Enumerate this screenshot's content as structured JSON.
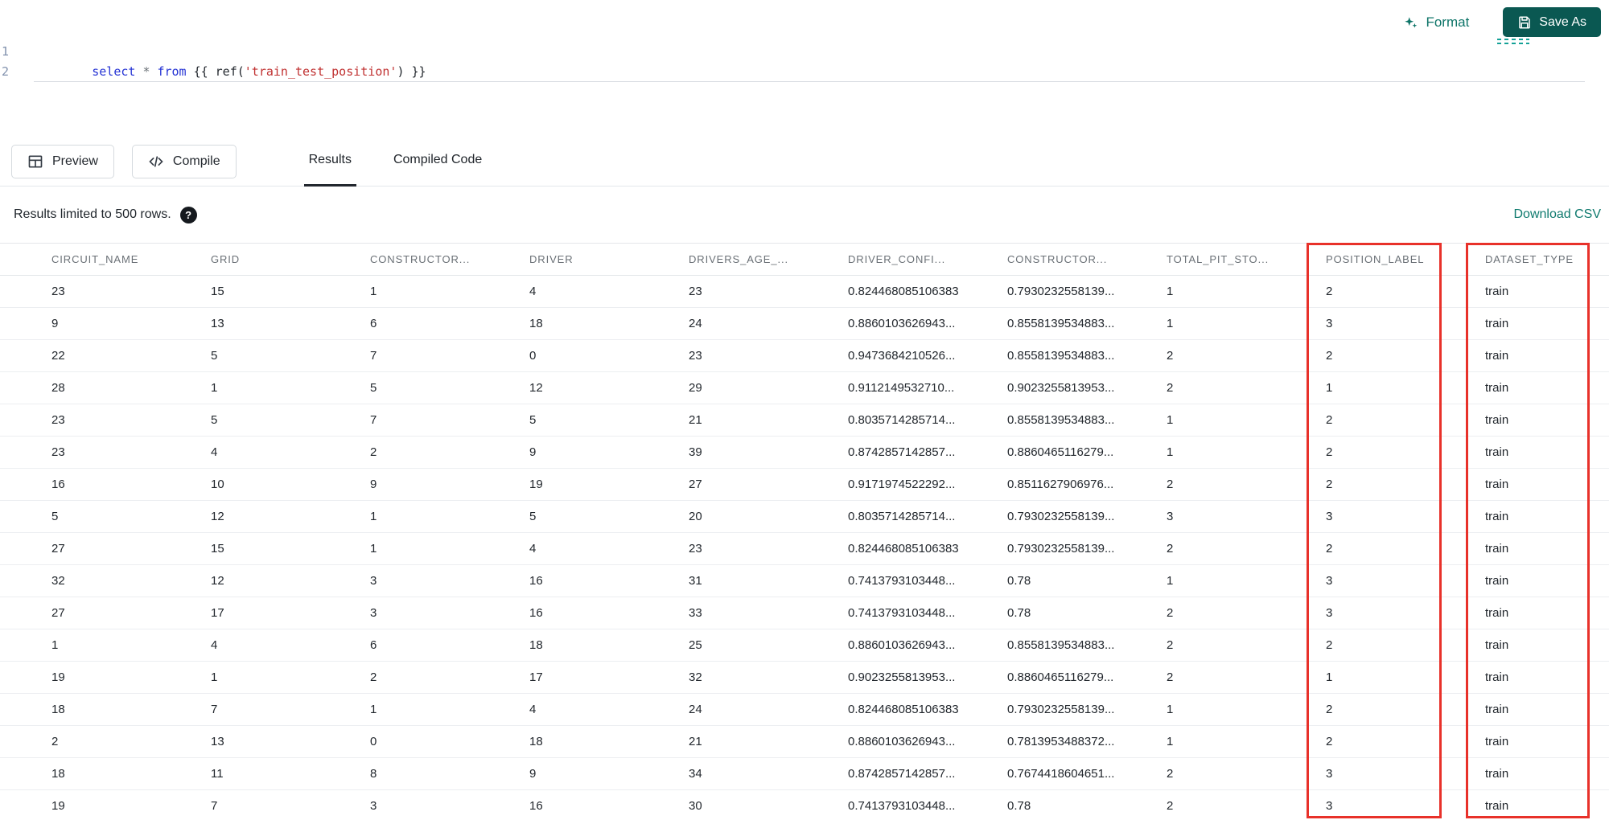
{
  "top_actions": {
    "format_label": "Format",
    "save_as_label": "Save As"
  },
  "editor": {
    "lines": [
      "1",
      "2"
    ],
    "code": {
      "kw_select": "select",
      "star": "*",
      "kw_from": "from",
      "jinja_open": "{{",
      "fn_ref": "ref(",
      "string_literal": "'train_test_position'",
      "paren_close": ")",
      "jinja_close": "}}"
    }
  },
  "toolbar": {
    "preview_label": "Preview",
    "compile_label": "Compile",
    "tabs": [
      {
        "label": "Results",
        "active": true
      },
      {
        "label": "Compiled Code",
        "active": false
      }
    ]
  },
  "results_bar": {
    "info_text": "Results limited to 500 rows.",
    "help_glyph": "?",
    "download_label": "Download CSV"
  },
  "table": {
    "headers": [
      "CIRCUIT_NAME",
      "GRID",
      "CONSTRUCTOR...",
      "DRIVER",
      "DRIVERS_AGE_...",
      "DRIVER_CONFI...",
      "CONSTRUCTOR...",
      "TOTAL_PIT_STO...",
      "POSITION_LABEL",
      "DATASET_TYPE"
    ],
    "highlighted_columns": [
      "POSITION_LABEL",
      "DATASET_TYPE"
    ],
    "rows": [
      [
        "23",
        "15",
        "1",
        "4",
        "23",
        "0.824468085106383",
        "0.7930232558139...",
        "1",
        "2",
        "train"
      ],
      [
        "9",
        "13",
        "6",
        "18",
        "24",
        "0.8860103626943...",
        "0.8558139534883...",
        "1",
        "3",
        "train"
      ],
      [
        "22",
        "5",
        "7",
        "0",
        "23",
        "0.9473684210526...",
        "0.8558139534883...",
        "2",
        "2",
        "train"
      ],
      [
        "28",
        "1",
        "5",
        "12",
        "29",
        "0.9112149532710...",
        "0.9023255813953...",
        "2",
        "1",
        "train"
      ],
      [
        "23",
        "5",
        "7",
        "5",
        "21",
        "0.8035714285714...",
        "0.8558139534883...",
        "1",
        "2",
        "train"
      ],
      [
        "23",
        "4",
        "2",
        "9",
        "39",
        "0.8742857142857...",
        "0.8860465116279...",
        "1",
        "2",
        "train"
      ],
      [
        "16",
        "10",
        "9",
        "19",
        "27",
        "0.9171974522292...",
        "0.8511627906976...",
        "2",
        "2",
        "train"
      ],
      [
        "5",
        "12",
        "1",
        "5",
        "20",
        "0.8035714285714...",
        "0.7930232558139...",
        "3",
        "3",
        "train"
      ],
      [
        "27",
        "15",
        "1",
        "4",
        "23",
        "0.824468085106383",
        "0.7930232558139...",
        "2",
        "2",
        "train"
      ],
      [
        "32",
        "12",
        "3",
        "16",
        "31",
        "0.7413793103448...",
        "0.78",
        "1",
        "3",
        "train"
      ],
      [
        "27",
        "17",
        "3",
        "16",
        "33",
        "0.7413793103448...",
        "0.78",
        "2",
        "3",
        "train"
      ],
      [
        "1",
        "4",
        "6",
        "18",
        "25",
        "0.8860103626943...",
        "0.8558139534883...",
        "2",
        "2",
        "train"
      ],
      [
        "19",
        "1",
        "2",
        "17",
        "32",
        "0.9023255813953...",
        "0.8860465116279...",
        "2",
        "1",
        "train"
      ],
      [
        "18",
        "7",
        "1",
        "4",
        "24",
        "0.824468085106383",
        "0.7930232558139...",
        "1",
        "2",
        "train"
      ],
      [
        "2",
        "13",
        "0",
        "18",
        "21",
        "0.8860103626943...",
        "0.7813953488372...",
        "1",
        "2",
        "train"
      ],
      [
        "18",
        "11",
        "8",
        "9",
        "34",
        "0.8742857142857...",
        "0.7674418604651...",
        "2",
        "3",
        "train"
      ],
      [
        "19",
        "7",
        "3",
        "16",
        "30",
        "0.7413793103448...",
        "0.78",
        "2",
        "3",
        "train"
      ]
    ]
  },
  "colors": {
    "accent_teal": "#0d7468",
    "save_button_bg": "#0a5852",
    "highlight_red": "#e8312a",
    "keyword_blue": "#2533d4",
    "string_red": "#c03131",
    "tab_underline": "#22272e"
  }
}
